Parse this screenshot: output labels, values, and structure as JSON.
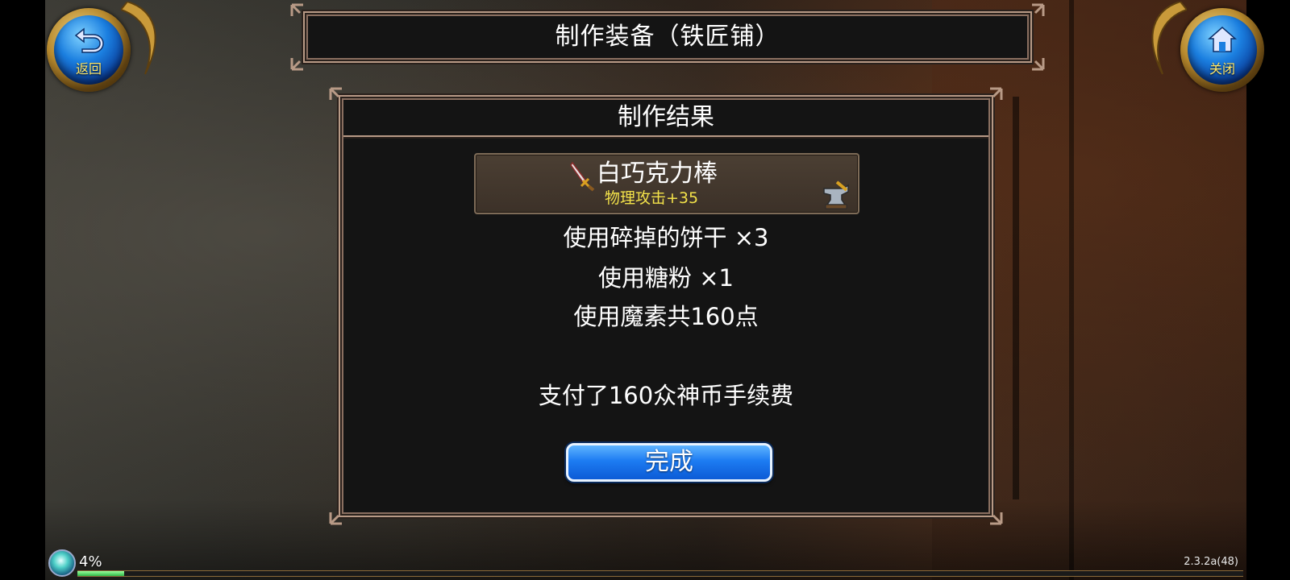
{
  "header": {
    "title": "制作装备（铁匠铺）",
    "back_button_label": "返回",
    "close_button_label": "关闭",
    "back_icon": "return-arrow-icon",
    "close_icon": "home-icon"
  },
  "dialog": {
    "title": "制作结果",
    "item": {
      "name": "白巧克力棒",
      "stat": "物理攻击+35",
      "item_icon": "sword-icon",
      "badge_icon": "anvil-icon"
    },
    "lines": [
      "使用碎掉的饼干 ×3",
      "使用糖粉 ×1",
      "使用魔素共160点"
    ],
    "fee_text": "支付了160众神币手续费",
    "done_button_label": "完成"
  },
  "status": {
    "exp_percent_label": "4%",
    "exp_fraction": 0.04,
    "version": "2.3.2a(48)"
  },
  "colors": {
    "stat_text": "#f3e24a",
    "button_blue": "#1d7cf2",
    "orb_label": "#ffe76a",
    "frame_border": "#b89a86"
  }
}
